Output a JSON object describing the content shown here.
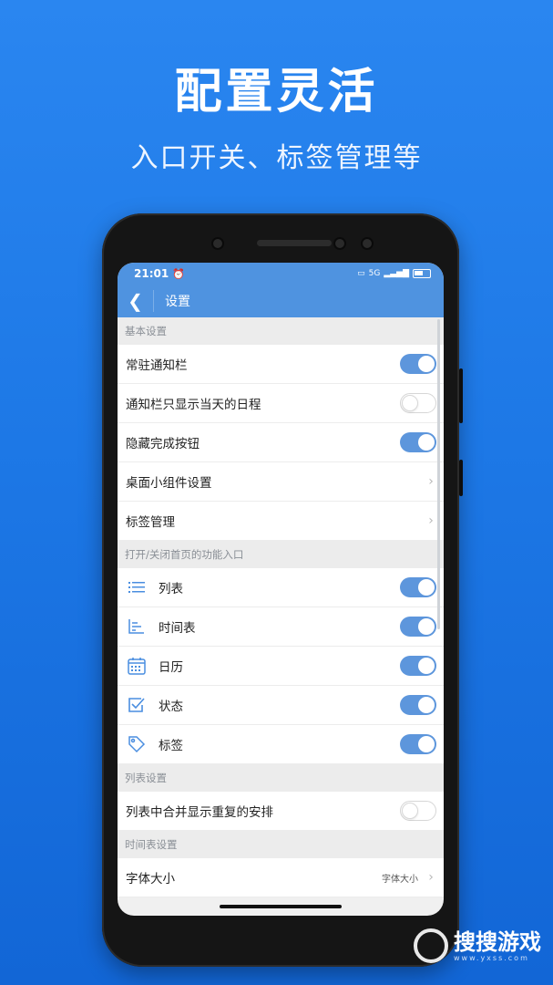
{
  "banner": {
    "title": "配置灵活",
    "subtitle": "入口开关、标签管理等"
  },
  "statusbar": {
    "time": "21:01",
    "network": "5G"
  },
  "appbar": {
    "back_label": "❮",
    "title": "设置"
  },
  "sections": {
    "basic": {
      "header": "基本设置",
      "items": [
        {
          "label": "常驻通知栏",
          "toggle": true
        },
        {
          "label": "通知栏只显示当天的日程",
          "toggle": false
        },
        {
          "label": "隐藏完成按钮",
          "toggle": true
        },
        {
          "label": "桌面小组件设置"
        },
        {
          "label": "标签管理"
        }
      ]
    },
    "entries": {
      "header": "打开/关闭首页的功能入口",
      "items": [
        {
          "label": "列表",
          "icon": "list-icon",
          "toggle": true
        },
        {
          "label": "时间表",
          "icon": "timeline-icon",
          "toggle": true
        },
        {
          "label": "日历",
          "icon": "calendar-icon",
          "toggle": true
        },
        {
          "label": "状态",
          "icon": "checkbox-icon",
          "toggle": true
        },
        {
          "label": "标签",
          "icon": "tag-icon",
          "toggle": true
        }
      ]
    },
    "list_settings": {
      "header": "列表设置",
      "items": [
        {
          "label": "列表中合并显示重复的安排",
          "toggle": false
        }
      ]
    },
    "timeline_settings": {
      "header": "时间表设置",
      "items": [
        {
          "label": "字体大小",
          "value": "字体大小"
        }
      ]
    }
  },
  "watermark": {
    "text": "搜搜游戏",
    "url": "www.yxss.com"
  },
  "colors": {
    "background": "#1d78e6",
    "appbar": "#4f93e0",
    "toggle_on": "#5d96dc"
  }
}
